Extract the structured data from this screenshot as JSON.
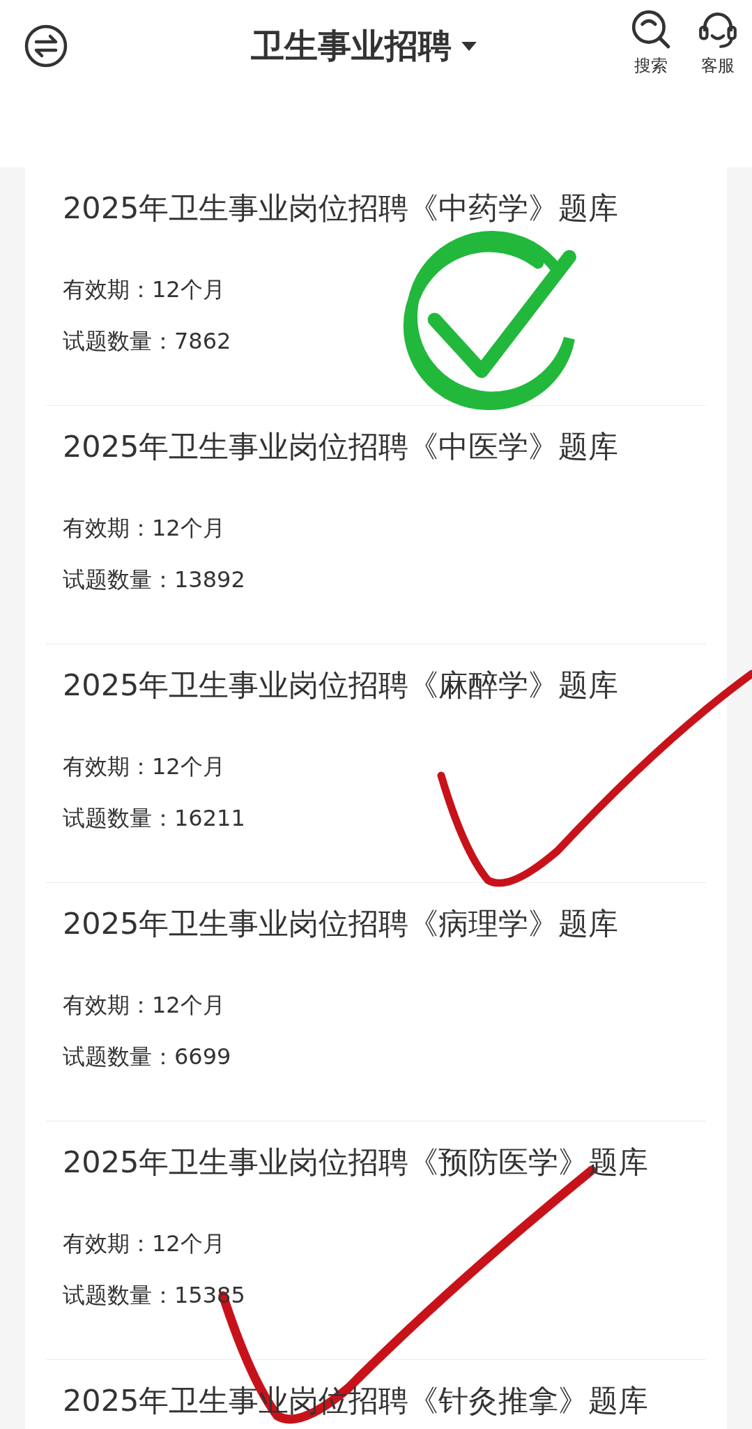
{
  "header": {
    "title": "卫生事业招聘",
    "actions": [
      {
        "kind": "search",
        "label": "搜索"
      },
      {
        "kind": "service",
        "label": "客服"
      }
    ]
  },
  "items": [
    {
      "title": "2025年卫生事业岗位招聘《中药学》题库",
      "validity": "有效期：12个月",
      "count": "试题数量：7862"
    },
    {
      "title": "2025年卫生事业岗位招聘《中医学》题库",
      "validity": "有效期：12个月",
      "count": "试题数量：13892"
    },
    {
      "title": "2025年卫生事业岗位招聘《麻醉学》题库",
      "validity": "有效期：12个月",
      "count": "试题数量：16211"
    },
    {
      "title": "2025年卫生事业岗位招聘《病理学》题库",
      "validity": "有效期：12个月",
      "count": "试题数量：6699"
    },
    {
      "title": "2025年卫生事业岗位招聘《预防医学》题库",
      "validity": "有效期：12个月",
      "count": "试题数量：15385"
    },
    {
      "title": "2025年卫生事业岗位招聘《针灸推拿》题库"
    }
  ]
}
